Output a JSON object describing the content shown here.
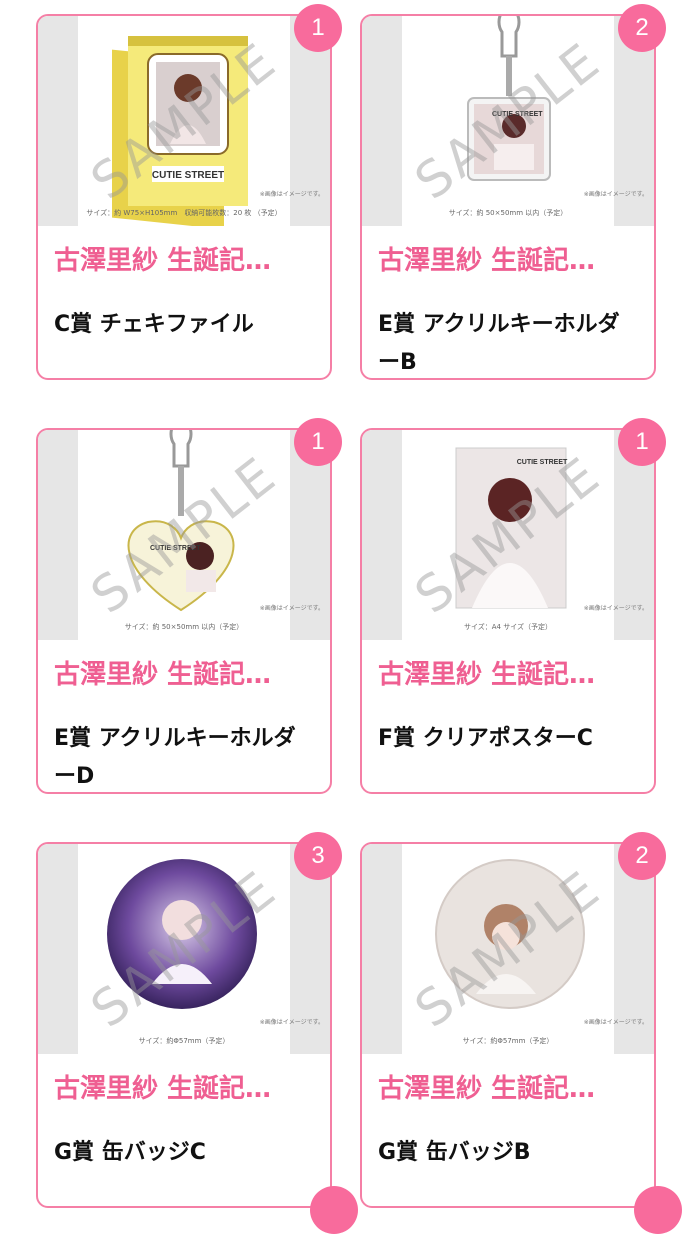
{
  "watermark": "SAMPLE",
  "items": [
    {
      "badge": "1",
      "title": "古澤里紗 生誕記…",
      "name": "C賞 チェキファイル",
      "size_note": "サイズ：約 W75×H105mm　収納可能枚数：20 枚 （予定）",
      "image_note": "※画像はイメージです。",
      "product_text": "CUTIE STREET",
      "product": "cheki-file"
    },
    {
      "badge": "2",
      "title": "古澤里紗 生誕記…",
      "name": "E賞 アクリルキーホルダーB",
      "size_note": "サイズ：約 50×50mm 以内（予定）",
      "image_note": "※画像はイメージです。",
      "product_text": "CUTIE STREET",
      "product": "keychain-square"
    },
    {
      "badge": "1",
      "title": "古澤里紗 生誕記…",
      "name": "E賞 アクリルキーホルダーD",
      "size_note": "サイズ：約 50×50mm 以内（予定）",
      "image_note": "※画像はイメージです。",
      "product_text": "CUTIE STREET",
      "product": "keychain-heart"
    },
    {
      "badge": "1",
      "title": "古澤里紗 生誕記…",
      "name": "F賞 クリアポスターC",
      "size_note": "サイズ：A4 サイズ（予定）",
      "image_note": "※画像はイメージです。",
      "product_text": "CUTIE STREET",
      "product": "clear-poster"
    },
    {
      "badge": "3",
      "title": "古澤里紗 生誕記…",
      "name": "G賞 缶バッジC",
      "size_note": "サイズ：約Φ57mm（予定）",
      "image_note": "※画像はイメージです。",
      "product_text": "",
      "product": "badge-purple"
    },
    {
      "badge": "2",
      "title": "古澤里紗 生誕記…",
      "name": "G賞 缶バッジB",
      "size_note": "サイズ：約Φ57mm（予定）",
      "image_note": "※画像はイメージです。",
      "product_text": "",
      "product": "badge-light"
    }
  ]
}
